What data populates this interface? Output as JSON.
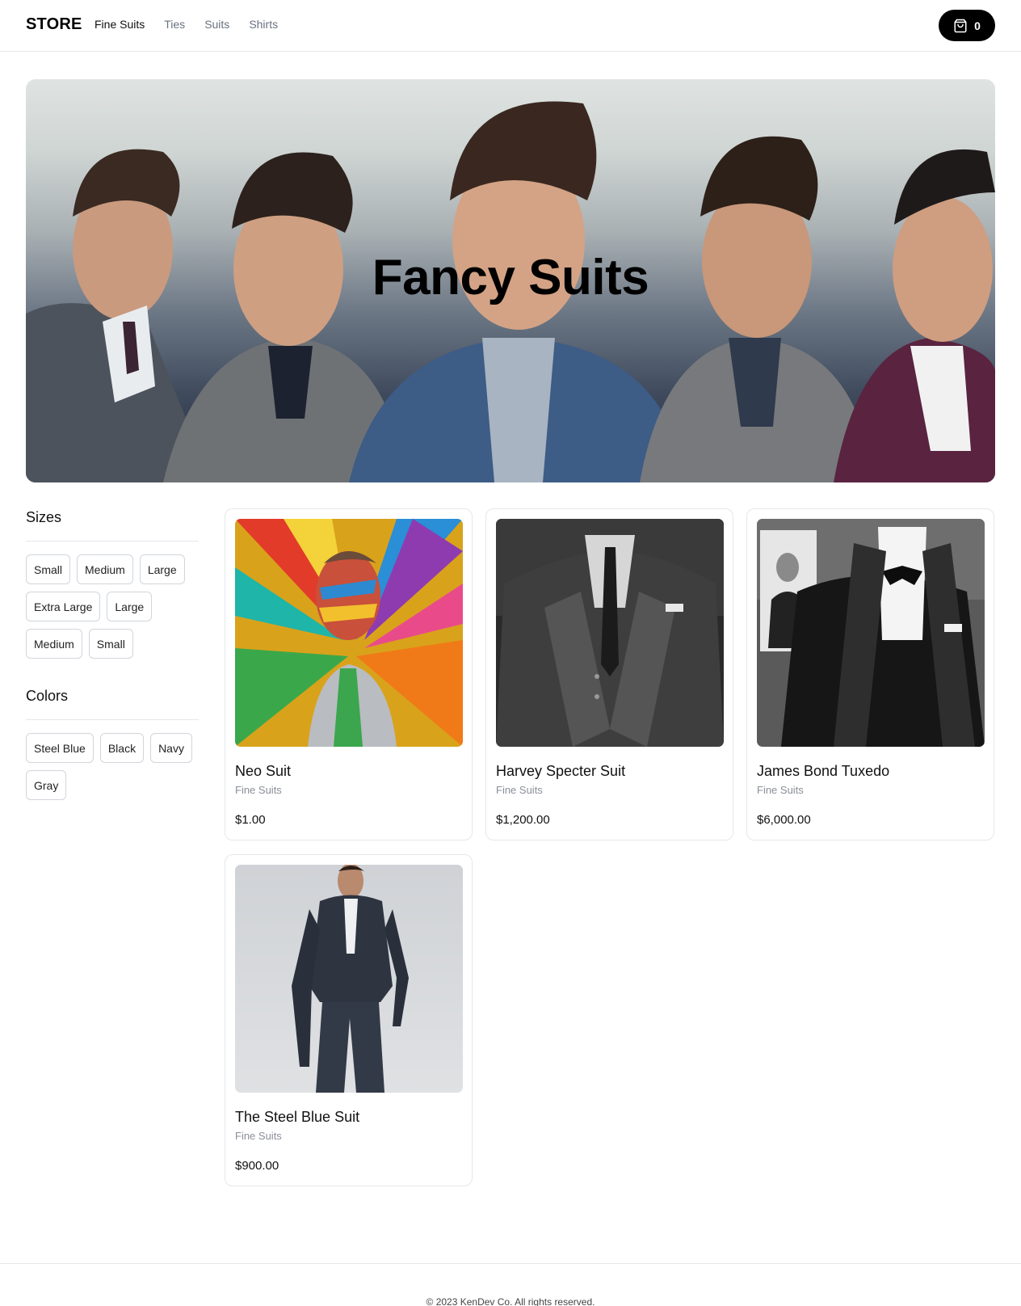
{
  "header": {
    "logo": "STORE",
    "nav": [
      {
        "label": "Fine Suits",
        "active": true
      },
      {
        "label": "Ties",
        "active": false
      },
      {
        "label": "Suits",
        "active": false
      },
      {
        "label": "Shirts",
        "active": false
      }
    ],
    "cart": {
      "icon": "shopping-bag-icon",
      "count": "0"
    }
  },
  "hero": {
    "title": "Fancy Suits"
  },
  "filters": {
    "sizes": {
      "title": "Sizes",
      "options": [
        "Small",
        "Medium",
        "Large",
        "Extra Large",
        "Large",
        "Medium",
        "Small"
      ]
    },
    "colors": {
      "title": "Colors",
      "options": [
        "Steel Blue",
        "Black",
        "Navy",
        "Gray"
      ]
    }
  },
  "products": [
    {
      "name": "Neo Suit",
      "category": "Fine Suits",
      "price": "$1.00"
    },
    {
      "name": "Harvey Specter Suit",
      "category": "Fine Suits",
      "price": "$1,200.00"
    },
    {
      "name": "James Bond Tuxedo",
      "category": "Fine Suits",
      "price": "$6,000.00"
    },
    {
      "name": "The Steel Blue Suit",
      "category": "Fine Suits",
      "price": "$900.00"
    }
  ],
  "footer": {
    "text": "© 2023 KenDev Co. All rights reserved."
  },
  "colors": {
    "accent": "#000000",
    "muted_text": "#6b7280",
    "border": "#e5e7eb"
  }
}
